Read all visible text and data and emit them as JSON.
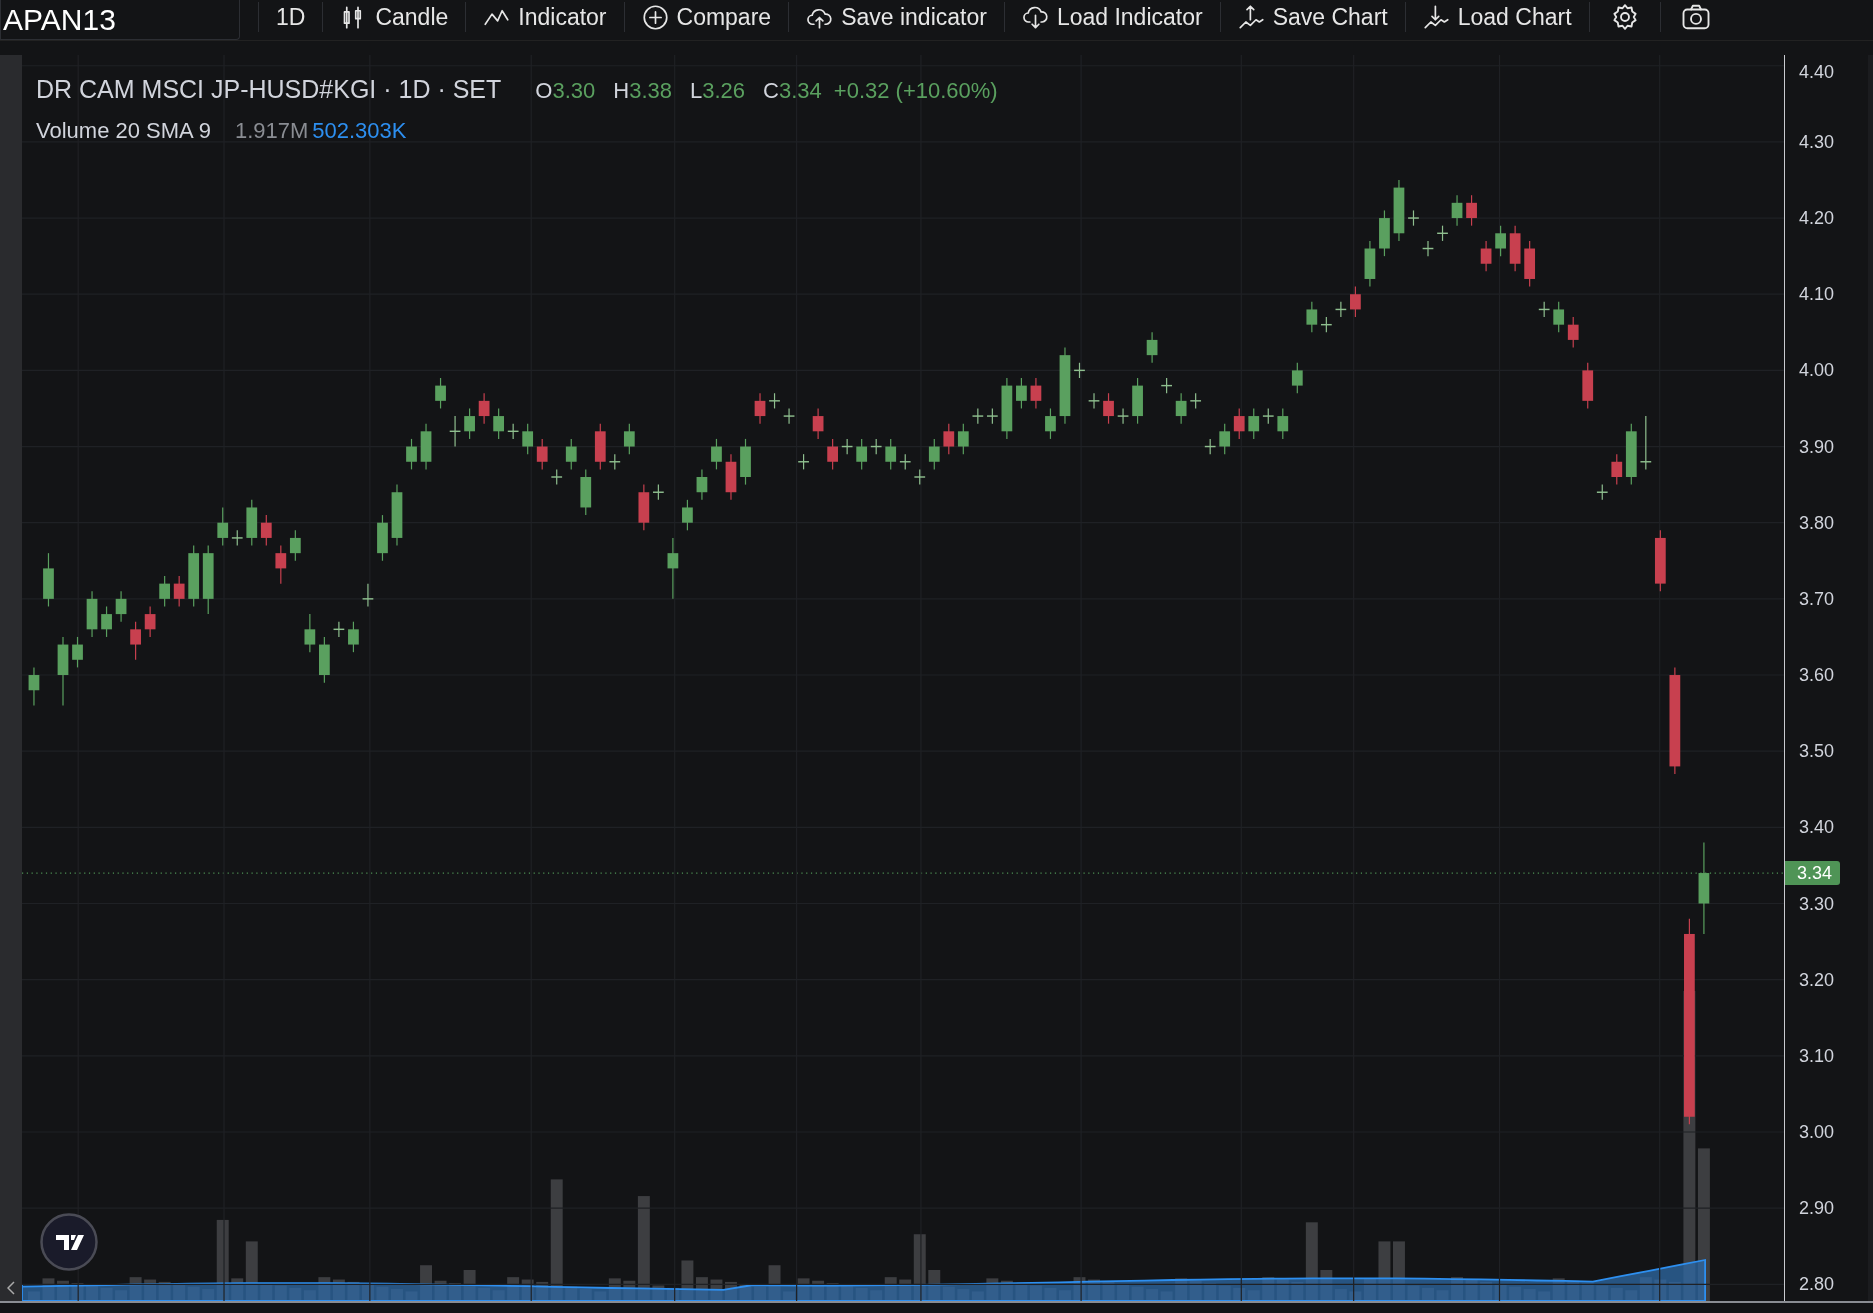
{
  "toolbar": {
    "symbol": "APAN13",
    "items": [
      {
        "kind": "interval",
        "label": "1D"
      },
      {
        "kind": "candle",
        "label": "Candle"
      },
      {
        "kind": "indicator",
        "label": "Indicator"
      },
      {
        "kind": "compare",
        "label": "Compare"
      },
      {
        "kind": "save-indicator",
        "label": "Save indicator"
      },
      {
        "kind": "load-indicator",
        "label": "Load Indicator"
      },
      {
        "kind": "save-chart",
        "label": "Save Chart"
      },
      {
        "kind": "load-chart",
        "label": "Load Chart"
      },
      {
        "kind": "settings"
      },
      {
        "kind": "camera"
      }
    ]
  },
  "legend": {
    "title": "DR CAM MSCI JP-HUSD#KGI · 1D · SET",
    "ohlc": [
      {
        "key": "O",
        "value": "3.30"
      },
      {
        "key": "H",
        "value": "3.38"
      },
      {
        "key": "L",
        "value": "3.26"
      },
      {
        "key": "C",
        "value": "3.34"
      }
    ],
    "change": "+0.32 (+10.60%)"
  },
  "volume_legend": {
    "label": "Volume 20 SMA 9",
    "volume": "1.917M",
    "sma": "502.303K"
  },
  "price_axis": {
    "last_price": "3.34"
  },
  "chart_data": {
    "type": "candlestick",
    "ylim": [
      2.8,
      4.4
    ],
    "grid": true,
    "yticks": [
      {
        "value": 4.4,
        "label": "4.40"
      },
      {
        "value": 4.3,
        "label": "4.30"
      },
      {
        "value": 4.2,
        "label": "4.20"
      },
      {
        "value": 4.1,
        "label": "4.10"
      },
      {
        "value": 4.0,
        "label": "4.00"
      },
      {
        "value": 3.9,
        "label": "3.90"
      },
      {
        "value": 3.8,
        "label": "3.80"
      },
      {
        "value": 3.7,
        "label": "3.70"
      },
      {
        "value": 3.6,
        "label": "3.60"
      },
      {
        "value": 3.5,
        "label": "3.50"
      },
      {
        "value": 3.4,
        "label": "3.40"
      },
      {
        "value": 3.3,
        "label": "3.30"
      },
      {
        "value": 3.2,
        "label": "3.20"
      },
      {
        "value": 3.1,
        "label": "3.10"
      },
      {
        "value": 3.0,
        "label": "3.00"
      },
      {
        "value": 2.9,
        "label": "2.90"
      },
      {
        "value": 2.8,
        "label": "2.80"
      }
    ],
    "ohlc": [
      [
        3.58,
        3.61,
        3.56,
        3.6
      ],
      [
        3.7,
        3.76,
        3.69,
        3.74
      ],
      [
        3.6,
        3.65,
        3.56,
        3.64
      ],
      [
        3.62,
        3.65,
        3.61,
        3.64
      ],
      [
        3.66,
        3.71,
        3.65,
        3.7
      ],
      [
        3.66,
        3.69,
        3.65,
        3.68
      ],
      [
        3.68,
        3.71,
        3.67,
        3.7
      ],
      [
        3.66,
        3.67,
        3.62,
        3.64
      ],
      [
        3.68,
        3.69,
        3.65,
        3.66
      ],
      [
        3.7,
        3.73,
        3.69,
        3.72
      ],
      [
        3.72,
        3.73,
        3.69,
        3.7
      ],
      [
        3.7,
        3.77,
        3.69,
        3.76
      ],
      [
        3.7,
        3.77,
        3.68,
        3.76
      ],
      [
        3.78,
        3.82,
        3.77,
        3.8
      ],
      [
        3.78,
        3.79,
        3.77,
        3.78
      ],
      [
        3.78,
        3.83,
        3.77,
        3.82
      ],
      [
        3.8,
        3.81,
        3.77,
        3.78
      ],
      [
        3.76,
        3.77,
        3.72,
        3.74
      ],
      [
        3.76,
        3.79,
        3.75,
        3.78
      ],
      [
        3.64,
        3.68,
        3.63,
        3.66
      ],
      [
        3.6,
        3.65,
        3.59,
        3.64
      ],
      [
        3.66,
        3.67,
        3.65,
        3.66
      ],
      [
        3.64,
        3.67,
        3.63,
        3.66
      ],
      [
        3.7,
        3.72,
        3.69,
        3.7
      ],
      [
        3.76,
        3.81,
        3.75,
        3.8
      ],
      [
        3.78,
        3.85,
        3.77,
        3.84
      ],
      [
        3.88,
        3.91,
        3.87,
        3.9
      ],
      [
        3.88,
        3.93,
        3.87,
        3.92
      ],
      [
        3.96,
        3.99,
        3.95,
        3.98
      ],
      [
        3.92,
        3.94,
        3.9,
        3.92
      ],
      [
        3.92,
        3.95,
        3.91,
        3.94
      ],
      [
        3.96,
        3.97,
        3.93,
        3.94
      ],
      [
        3.92,
        3.95,
        3.91,
        3.94
      ],
      [
        3.92,
        3.93,
        3.91,
        3.92
      ],
      [
        3.9,
        3.93,
        3.89,
        3.92
      ],
      [
        3.9,
        3.91,
        3.87,
        3.88
      ],
      [
        3.86,
        3.87,
        3.85,
        3.86
      ],
      [
        3.88,
        3.91,
        3.87,
        3.9
      ],
      [
        3.82,
        3.87,
        3.81,
        3.86
      ],
      [
        3.92,
        3.93,
        3.87,
        3.88
      ],
      [
        3.88,
        3.89,
        3.87,
        3.88
      ],
      [
        3.9,
        3.93,
        3.89,
        3.92
      ],
      [
        3.84,
        3.85,
        3.79,
        3.8
      ],
      [
        3.84,
        3.85,
        3.83,
        3.84
      ],
      [
        3.74,
        3.78,
        3.7,
        3.76
      ],
      [
        3.8,
        3.83,
        3.79,
        3.82
      ],
      [
        3.84,
        3.87,
        3.83,
        3.86
      ],
      [
        3.88,
        3.91,
        3.87,
        3.9
      ],
      [
        3.88,
        3.89,
        3.83,
        3.84
      ],
      [
        3.86,
        3.91,
        3.85,
        3.9
      ],
      [
        3.96,
        3.97,
        3.93,
        3.94
      ],
      [
        3.96,
        3.97,
        3.95,
        3.96
      ],
      [
        3.94,
        3.95,
        3.93,
        3.94
      ],
      [
        3.88,
        3.89,
        3.87,
        3.88
      ],
      [
        3.94,
        3.95,
        3.91,
        3.92
      ],
      [
        3.9,
        3.91,
        3.87,
        3.88
      ],
      [
        3.9,
        3.91,
        3.89,
        3.9
      ],
      [
        3.88,
        3.91,
        3.87,
        3.9
      ],
      [
        3.9,
        3.91,
        3.89,
        3.9
      ],
      [
        3.88,
        3.91,
        3.87,
        3.9
      ],
      [
        3.88,
        3.89,
        3.87,
        3.88
      ],
      [
        3.86,
        3.87,
        3.85,
        3.86
      ],
      [
        3.88,
        3.91,
        3.87,
        3.9
      ],
      [
        3.92,
        3.93,
        3.89,
        3.9
      ],
      [
        3.9,
        3.93,
        3.89,
        3.92
      ],
      [
        3.94,
        3.95,
        3.93,
        3.94
      ],
      [
        3.94,
        3.95,
        3.93,
        3.94
      ],
      [
        3.92,
        3.99,
        3.91,
        3.98
      ],
      [
        3.96,
        3.99,
        3.95,
        3.98
      ],
      [
        3.98,
        3.99,
        3.95,
        3.96
      ],
      [
        3.92,
        3.95,
        3.91,
        3.94
      ],
      [
        3.94,
        4.03,
        3.93,
        4.02
      ],
      [
        4.0,
        4.01,
        3.99,
        4.0
      ],
      [
        3.96,
        3.97,
        3.95,
        3.96
      ],
      [
        3.96,
        3.97,
        3.93,
        3.94
      ],
      [
        3.94,
        3.95,
        3.93,
        3.94
      ],
      [
        3.94,
        3.99,
        3.93,
        3.98
      ],
      [
        4.02,
        4.05,
        4.01,
        4.04
      ],
      [
        3.98,
        3.99,
        3.97,
        3.98
      ],
      [
        3.94,
        3.97,
        3.93,
        3.96
      ],
      [
        3.96,
        3.97,
        3.95,
        3.96
      ],
      [
        3.9,
        3.91,
        3.89,
        3.9
      ],
      [
        3.9,
        3.93,
        3.89,
        3.92
      ],
      [
        3.94,
        3.95,
        3.91,
        3.92
      ],
      [
        3.92,
        3.95,
        3.91,
        3.94
      ],
      [
        3.94,
        3.95,
        3.93,
        3.94
      ],
      [
        3.92,
        3.95,
        3.91,
        3.94
      ],
      [
        3.98,
        4.01,
        3.97,
        4.0
      ],
      [
        4.06,
        4.09,
        4.05,
        4.08
      ],
      [
        4.06,
        4.07,
        4.05,
        4.06
      ],
      [
        4.08,
        4.09,
        4.07,
        4.08
      ],
      [
        4.1,
        4.11,
        4.07,
        4.08
      ],
      [
        4.12,
        4.17,
        4.11,
        4.16
      ],
      [
        4.16,
        4.21,
        4.15,
        4.2
      ],
      [
        4.18,
        4.25,
        4.17,
        4.24
      ],
      [
        4.2,
        4.21,
        4.19,
        4.2
      ],
      [
        4.16,
        4.17,
        4.15,
        4.16
      ],
      [
        4.18,
        4.19,
        4.17,
        4.18
      ],
      [
        4.2,
        4.23,
        4.19,
        4.22
      ],
      [
        4.22,
        4.23,
        4.19,
        4.2
      ],
      [
        4.16,
        4.17,
        4.13,
        4.14
      ],
      [
        4.16,
        4.19,
        4.15,
        4.18
      ],
      [
        4.18,
        4.19,
        4.13,
        4.14
      ],
      [
        4.16,
        4.17,
        4.11,
        4.12
      ],
      [
        4.08,
        4.09,
        4.07,
        4.08
      ],
      [
        4.06,
        4.09,
        4.05,
        4.08
      ],
      [
        4.06,
        4.07,
        4.03,
        4.04
      ],
      [
        4.0,
        4.01,
        3.95,
        3.96
      ],
      [
        3.84,
        3.85,
        3.83,
        3.84
      ],
      [
        3.88,
        3.89,
        3.85,
        3.86
      ],
      [
        3.86,
        3.93,
        3.85,
        3.92
      ],
      [
        3.88,
        3.94,
        3.87,
        3.88
      ],
      [
        3.78,
        3.79,
        3.71,
        3.72
      ],
      [
        3.6,
        3.61,
        3.47,
        3.48
      ],
      [
        3.26,
        3.28,
        3.01,
        3.02
      ],
      [
        3.3,
        3.38,
        3.26,
        3.34
      ]
    ]
  }
}
